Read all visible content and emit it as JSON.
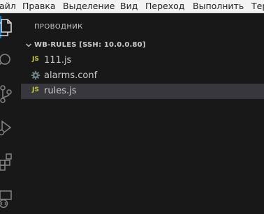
{
  "menu": [
    "айл",
    "Правка",
    "Выделение",
    "Вид",
    "Переход",
    "Выполнить",
    "Тер"
  ],
  "activity_bar": {
    "icons": [
      "explorer-icon",
      "search-icon",
      "source-control-icon",
      "run-debug-icon",
      "extensions-icon",
      "remote-explorer-icon"
    ],
    "active": "explorer-icon",
    "accent_color": "#0078d4"
  },
  "sidebar": {
    "title": "ПРОВОДНИК",
    "folder": "WB-RULES [SSH: 10.0.0.80]",
    "files": [
      {
        "icon_text": "JS",
        "icon": "js-file-icon",
        "name": "111.js",
        "selected": false
      },
      {
        "icon_text": "",
        "icon": "gear-file-icon",
        "name": "alarms.conf",
        "selected": false
      },
      {
        "icon_text": "JS",
        "icon": "js-file-icon",
        "name": "rules.js",
        "selected": true
      }
    ]
  },
  "colors": {
    "background": "#181818",
    "selection": "#37373d",
    "js_icon": "#cbcb41",
    "gear_icon": "#6d8086"
  }
}
